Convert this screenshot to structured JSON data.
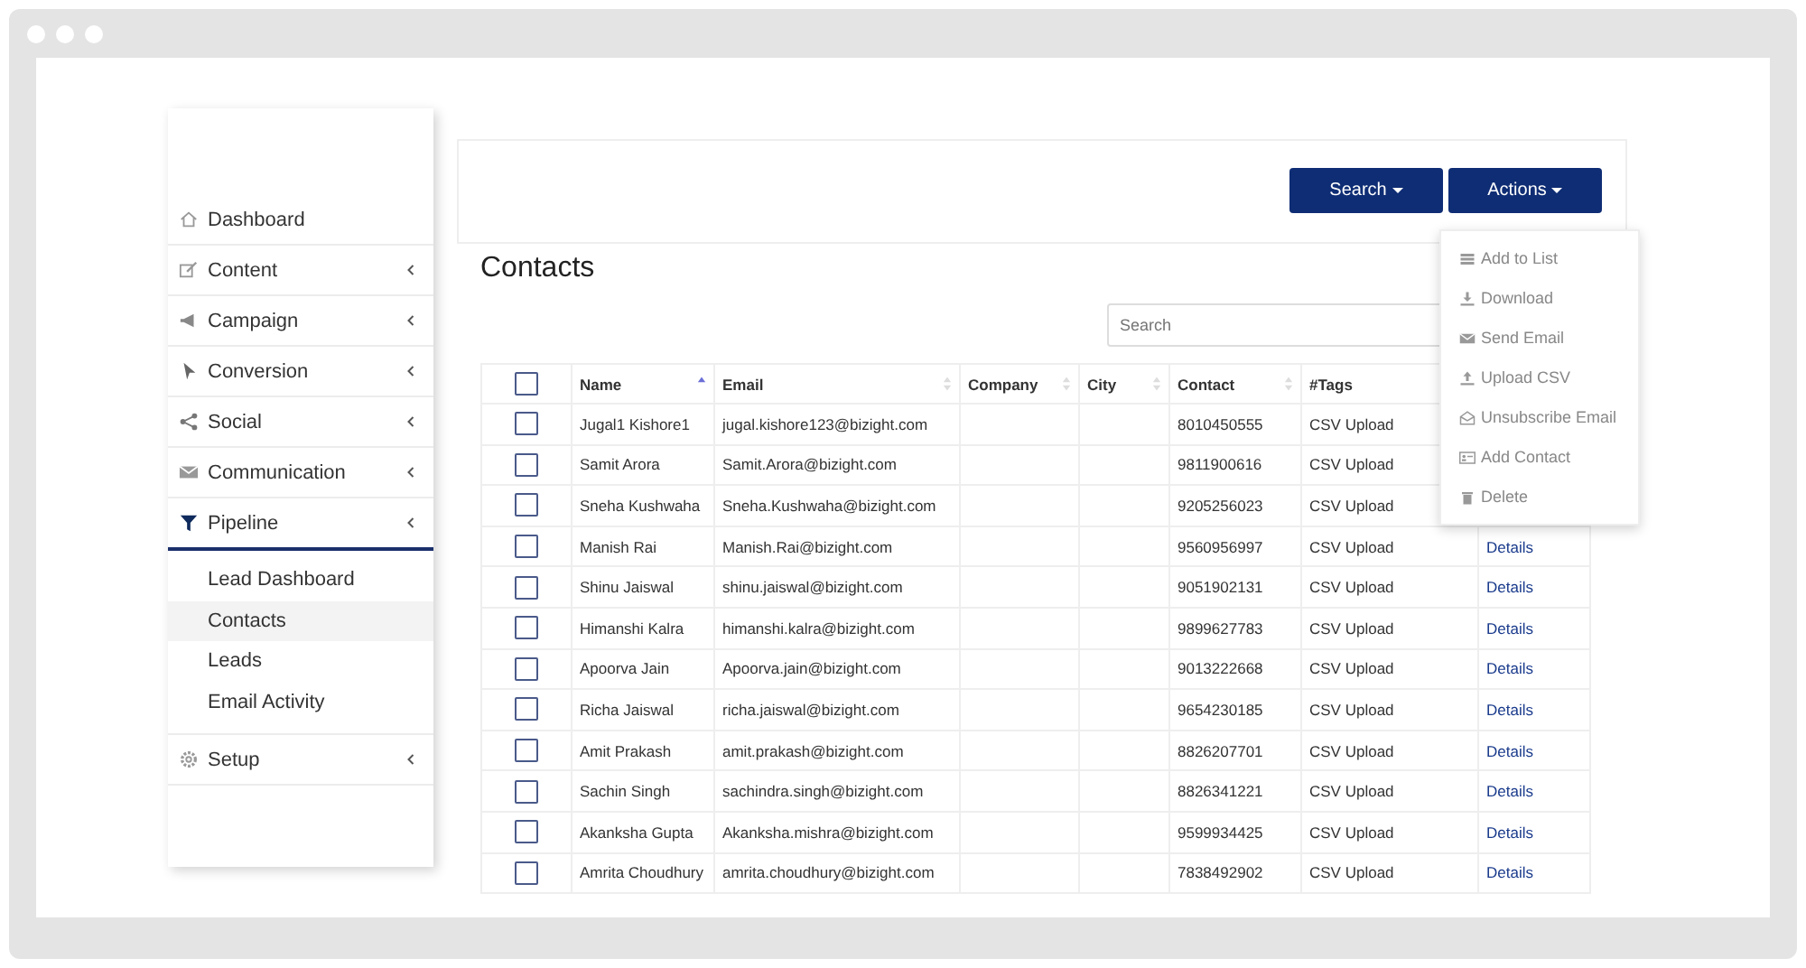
{
  "sidebar": {
    "items": [
      {
        "label": "Dashboard",
        "has_submenu": false,
        "expanded": false
      },
      {
        "label": "Content",
        "has_submenu": true,
        "expanded": false
      },
      {
        "label": "Campaign",
        "has_submenu": true,
        "expanded": false
      },
      {
        "label": "Conversion",
        "has_submenu": true,
        "expanded": false
      },
      {
        "label": "Social",
        "has_submenu": true,
        "expanded": false
      },
      {
        "label": "Communication",
        "has_submenu": true,
        "expanded": false
      },
      {
        "label": "Pipeline",
        "has_submenu": true,
        "expanded": true,
        "children": [
          {
            "label": "Lead Dashboard",
            "selected": false
          },
          {
            "label": "Contacts",
            "selected": true
          },
          {
            "label": "Leads",
            "selected": false
          },
          {
            "label": "Email Activity",
            "selected": false
          }
        ]
      },
      {
        "label": "Setup",
        "has_submenu": true,
        "expanded": false
      }
    ]
  },
  "toolbar": {
    "buttons": [
      "Search",
      "Actions"
    ]
  },
  "page_title": "Contacts",
  "search": {
    "placeholder": "Search"
  },
  "actions_menu": [
    {
      "label": "Add to List"
    },
    {
      "label": "Download"
    },
    {
      "label": "Send Email"
    },
    {
      "label": "Upload CSV"
    },
    {
      "label": "Unsubscribe Email"
    },
    {
      "label": "Add Contact"
    },
    {
      "label": "Delete"
    }
  ],
  "table": {
    "select_all_checked": false,
    "columns": [
      {
        "label": "Name",
        "sorted": true
      },
      {
        "label": "Email",
        "sorted": false
      },
      {
        "label": "Company",
        "sorted": false
      },
      {
        "label": "City",
        "sorted": false
      },
      {
        "label": "Contact",
        "sorted": false
      },
      {
        "label": "#Tags"
      }
    ],
    "rows": [
      {
        "checked": false,
        "name": "Jugal1 Kishore1",
        "email": "jugal.kishore123@bizight.com",
        "contact": "8010450555",
        "tags": "CSV Upload"
      },
      {
        "checked": false,
        "name": "Samit Arora",
        "email": "Samit.Arora@bizight.com",
        "contact": "9811900616",
        "tags": "CSV Upload"
      },
      {
        "checked": false,
        "name": "Sneha Kushwaha",
        "email": "Sneha.Kushwaha@bizight.com",
        "contact": "9205256023",
        "tags": "CSV Upload"
      },
      {
        "checked": false,
        "name": "Manish Rai",
        "email": "Manish.Rai@bizight.com",
        "contact": "9560956997",
        "tags": "CSV Upload",
        "link": "Details"
      },
      {
        "checked": false,
        "name": "Shinu Jaiswal",
        "email": "shinu.jaiswal@bizight.com",
        "contact": "9051902131",
        "tags": "CSV Upload",
        "link": "Details"
      },
      {
        "checked": false,
        "name": "Himanshi Kalra",
        "email": "himanshi.kalra@bizight.com",
        "contact": "9899627783",
        "tags": "CSV Upload",
        "link": "Details"
      },
      {
        "checked": false,
        "name": "Apoorva Jain",
        "email": "Apoorva.jain@bizight.com",
        "contact": "9013222668",
        "tags": "CSV Upload",
        "link": "Details"
      },
      {
        "checked": false,
        "name": "Richa Jaiswal",
        "email": "richa.jaiswal@bizight.com",
        "contact": "9654230185",
        "tags": "CSV Upload",
        "link": "Details"
      },
      {
        "checked": false,
        "name": "Amit Prakash",
        "email": "amit.prakash@bizight.com",
        "contact": "8826207701",
        "tags": "CSV Upload",
        "link": "Details"
      },
      {
        "checked": false,
        "name": "Sachin Singh",
        "email": "sachindra.singh@bizight.com",
        "contact": "8826341221",
        "tags": "CSV Upload",
        "link": "Details"
      },
      {
        "checked": false,
        "name": "Akanksha Gupta",
        "email": "Akanksha.mishra@bizight.com",
        "contact": "9599934425",
        "tags": "CSV Upload",
        "link": "Details"
      },
      {
        "checked": false,
        "name": "Amrita Choudhury",
        "email": "amrita.choudhury@bizight.com",
        "contact": "7838492902",
        "tags": "CSV Upload",
        "link": "Details"
      }
    ]
  }
}
